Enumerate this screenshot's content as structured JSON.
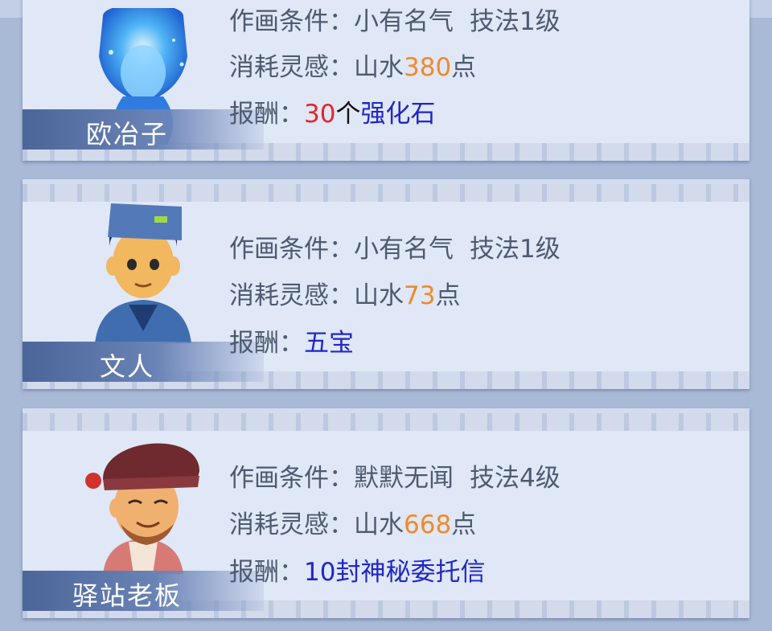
{
  "commissions": [
    {
      "npc_name": "欧冶子",
      "condition_label": "作画条件：",
      "condition_fame": "小有名气",
      "condition_skill": "技法1级",
      "cost_label": "消耗灵感：",
      "cost_type": "山水",
      "cost_value": "380",
      "cost_unit": "点",
      "reward_label": "报酬：",
      "reward_count": "30",
      "reward_measure": "个",
      "reward_item": "强化石"
    },
    {
      "npc_name": "文人",
      "condition_label": "作画条件：",
      "condition_fame": "小有名气",
      "condition_skill": "技法1级",
      "cost_label": "消耗灵感：",
      "cost_type": "山水",
      "cost_value": "73",
      "cost_unit": "点",
      "reward_label": "报酬：",
      "reward_item": "五宝"
    },
    {
      "npc_name": "驿站老板",
      "condition_label": "作画条件：",
      "condition_fame": "默默无闻",
      "condition_skill": "技法4级",
      "cost_label": "消耗灵感：",
      "cost_type": "山水",
      "cost_value": "668",
      "cost_unit": "点",
      "reward_label": "报酬：",
      "reward_item": "10封神秘委托信"
    }
  ],
  "colors": {
    "number_orange": "#f08a2a",
    "reward_blue": "#1f27c6",
    "count_red": "#e2262b",
    "label_gray": "#4d5a70"
  }
}
